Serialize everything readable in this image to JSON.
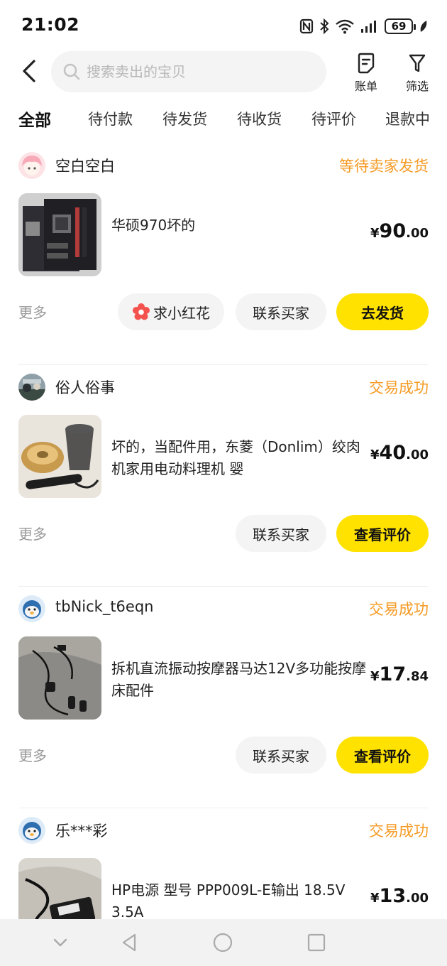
{
  "status_bar": {
    "time": "21:02",
    "battery": "69"
  },
  "header": {
    "search_placeholder": "搜索卖出的宝贝",
    "bill_label": "账单",
    "filter_label": "筛选"
  },
  "tabs": [
    {
      "label": "全部",
      "active": true
    },
    {
      "label": "待付款"
    },
    {
      "label": "待发货"
    },
    {
      "label": "待收货"
    },
    {
      "label": "待评价"
    },
    {
      "label": "退款中"
    }
  ],
  "orders": [
    {
      "buyer": "空白空白",
      "status": "等待卖家发货",
      "title": "华硕970坏的",
      "price": {
        "currency": "¥",
        "integer": "90",
        "decimal": ".00"
      },
      "more_label": "更多",
      "buttons": [
        "求小红花",
        "联系买家",
        "去发货"
      ]
    },
    {
      "buyer": "俗人俗事",
      "status": "交易成功",
      "title": "坏的，当配件用，东菱（Donlim）绞肉机家用电动料理机 婴",
      "price": {
        "currency": "¥",
        "integer": "40",
        "decimal": ".00"
      },
      "more_label": "更多",
      "buttons": [
        "联系买家",
        "查看评价"
      ]
    },
    {
      "buyer": "tbNick_t6eqn",
      "status": "交易成功",
      "title": "拆机直流振动按摩器马达12V多功能按摩床配件",
      "price": {
        "currency": "¥",
        "integer": "17",
        "decimal": ".84"
      },
      "more_label": "更多",
      "buttons": [
        "联系买家",
        "查看评价"
      ]
    },
    {
      "buyer": "乐***彩",
      "status": "交易成功",
      "title": "HP电源 型号 PPP009L-E输出 18.5V 3.5A",
      "price": {
        "currency": "¥",
        "integer": "13",
        "decimal": ".00"
      }
    }
  ],
  "colors": {
    "accent_yellow": "#ffe200",
    "status_orange": "#f59a23",
    "flower_red": "#f4524d"
  }
}
